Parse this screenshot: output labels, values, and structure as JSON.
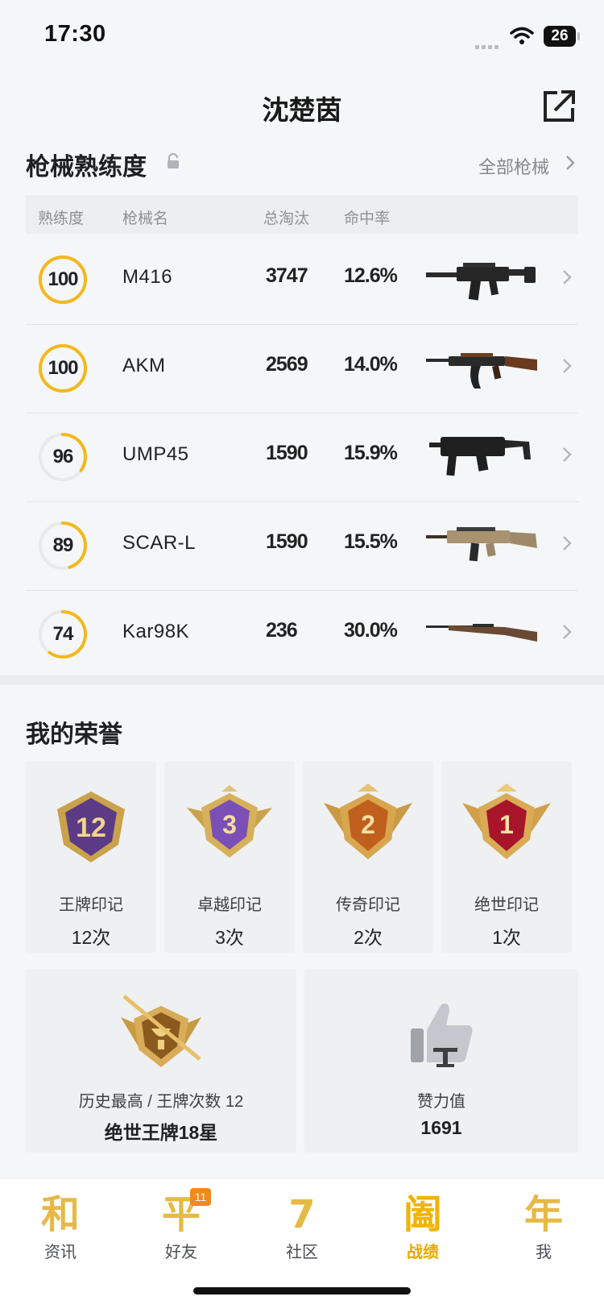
{
  "status_bar": {
    "time": "17:30",
    "battery": "26"
  },
  "header": {
    "title": "沈楚茵"
  },
  "guns_section": {
    "title": "枪械熟练度",
    "all_link": "全部枪械",
    "columns": {
      "mastery": "熟练度",
      "name": "枪械名",
      "kills": "总淘汰",
      "accuracy": "命中率"
    },
    "rows": [
      {
        "mastery": "100",
        "progress": 1.0,
        "name": "M416",
        "kills": "3747",
        "accuracy": "12.6%"
      },
      {
        "mastery": "100",
        "progress": 1.0,
        "name": "AKM",
        "kills": "2569",
        "accuracy": "14.0%"
      },
      {
        "mastery": "96",
        "progress": 0.35,
        "name": "UMP45",
        "kills": "1590",
        "accuracy": "15.9%"
      },
      {
        "mastery": "89",
        "progress": 0.45,
        "name": "SCAR-L",
        "kills": "1590",
        "accuracy": "15.5%"
      },
      {
        "mastery": "74",
        "progress": 0.6,
        "name": "Kar98K",
        "kills": "236",
        "accuracy": "30.0%"
      }
    ]
  },
  "honor_section": {
    "title": "我的荣誉",
    "medals": [
      {
        "badge": "12",
        "label": "王牌印记",
        "count": "12次"
      },
      {
        "badge": "3",
        "label": "卓越印记",
        "count": "3次"
      },
      {
        "badge": "2",
        "label": "传奇印记",
        "count": "2次"
      },
      {
        "badge": "1",
        "label": "绝世印记",
        "count": "1次"
      }
    ],
    "highest": {
      "label": "历史最高 / 王牌次数 12",
      "value": "绝世王牌18星"
    },
    "likes": {
      "label": "赞力值",
      "value": "1691"
    }
  },
  "tabbar": {
    "items": [
      {
        "glyph": "和",
        "label": "资讯"
      },
      {
        "glyph": "平",
        "label": "好友",
        "badge": "11"
      },
      {
        "glyph": "7",
        "label": "社区"
      },
      {
        "glyph": "阖",
        "label": "战绩",
        "active": true
      },
      {
        "glyph": "年",
        "label": "我"
      }
    ],
    "active_color": "#f0b400",
    "gold": "#e6b946"
  }
}
